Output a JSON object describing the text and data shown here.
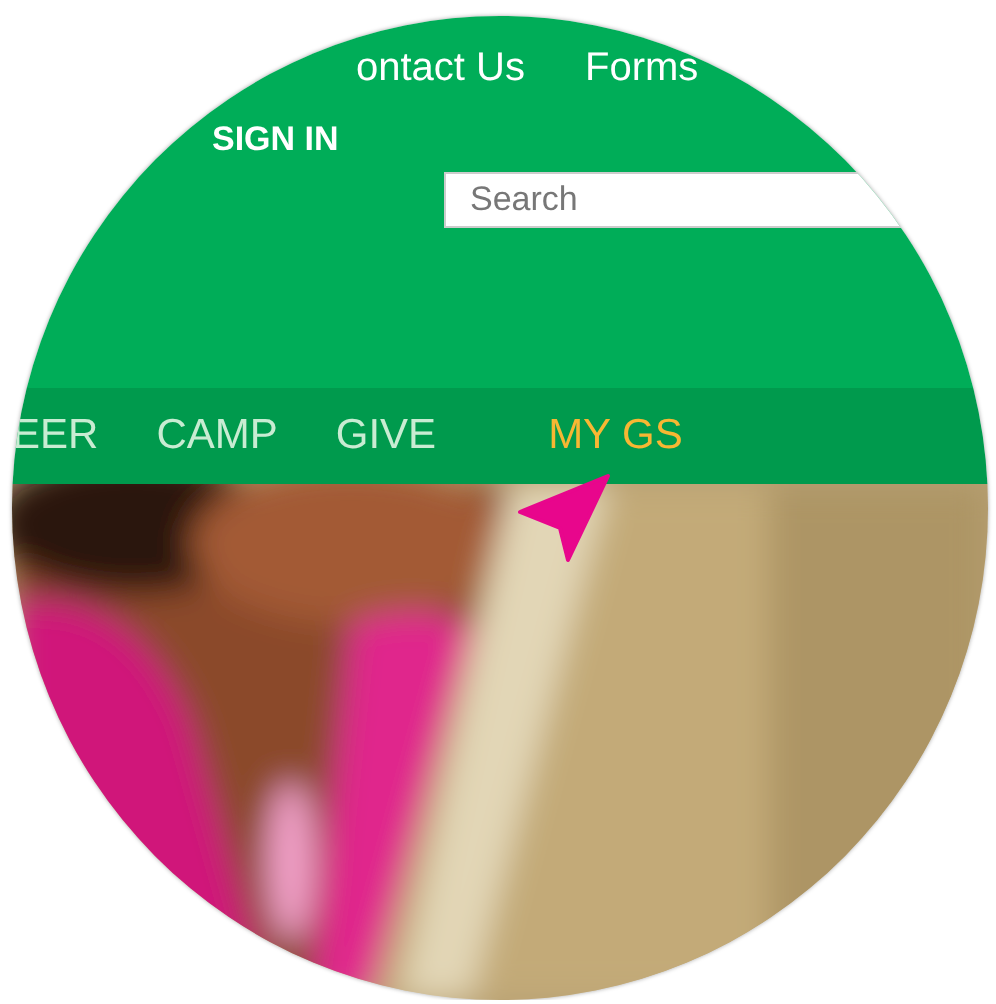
{
  "top_links": [
    {
      "label": "ontact Us"
    },
    {
      "label": "Forms"
    }
  ],
  "sign_in": {
    "label": "SIGN IN"
  },
  "search": {
    "placeholder": "Search"
  },
  "nav": [
    {
      "label": "EER",
      "selected": false
    },
    {
      "label": "CAMP",
      "selected": false
    },
    {
      "label": "GIVE",
      "selected": false
    },
    {
      "label": "MY GS",
      "selected": true
    }
  ]
}
